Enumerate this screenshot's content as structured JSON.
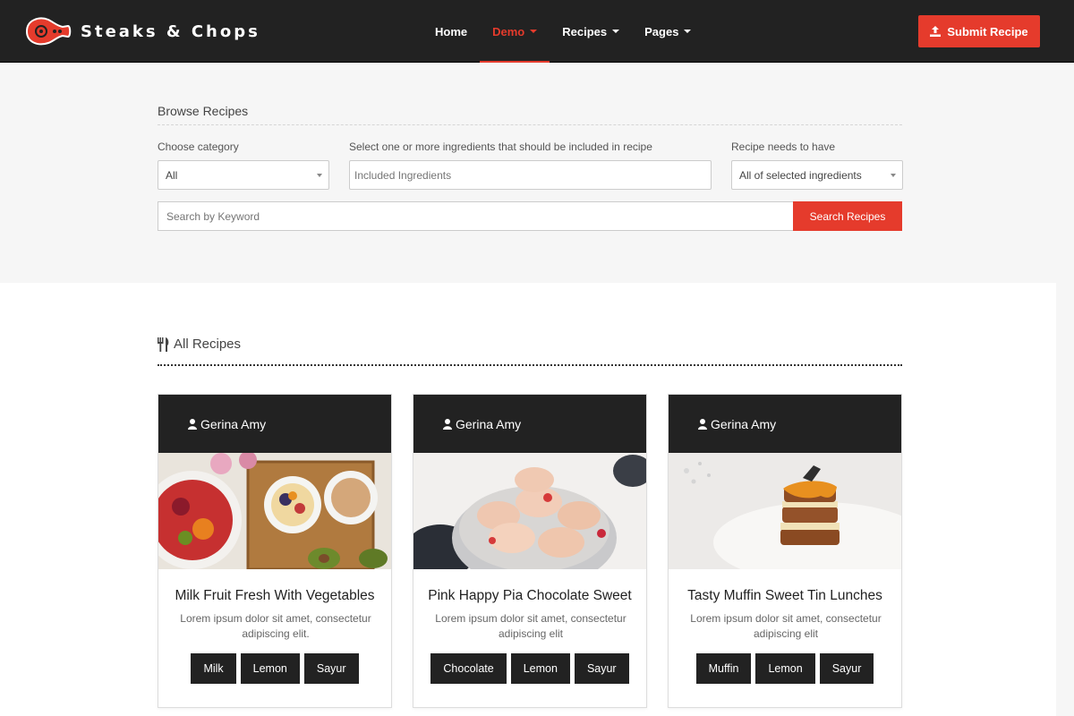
{
  "brand": {
    "name": "Steaks & Chops"
  },
  "nav": {
    "home": "Home",
    "demo": "Demo",
    "recipes": "Recipes",
    "pages": "Pages"
  },
  "submit": {
    "label": "Submit Recipe"
  },
  "search": {
    "title": "Browse Recipes",
    "category_label": "Choose category",
    "category_value": "All",
    "ingredients_label": "Select one or more ingredients that should be included in recipe",
    "ingredients_placeholder": "Included Ingredients",
    "needs_label": "Recipe needs to have",
    "needs_value": "All of selected ingredients",
    "keyword_placeholder": "Search by Keyword",
    "button": "Search Recipes"
  },
  "recipes": {
    "title": "All Recipes",
    "cards": [
      {
        "author": "Gerina Amy",
        "title": "Milk Fruit Fresh With Vegetables",
        "desc": "Lorem ipsum dolor sit amet, consectetur adipiscing elit.",
        "tags": [
          "Milk",
          "Lemon",
          "Sayur"
        ]
      },
      {
        "author": "Gerina Amy",
        "title": "Pink Happy Pia Chocolate Sweet",
        "desc": "Lorem ipsum dolor sit amet, consectetur adipiscing elit",
        "tags": [
          "Chocolate",
          "Lemon",
          "Sayur"
        ]
      },
      {
        "author": "Gerina Amy",
        "title": "Tasty Muffin Sweet Tin Lunches",
        "desc": "Lorem ipsum dolor sit amet, consectetur adipiscing elit",
        "tags": [
          "Muffin",
          "Lemon",
          "Sayur"
        ]
      }
    ]
  },
  "colors": {
    "accent": "#e53b2c",
    "dark": "#222222",
    "light_bg": "#f6f6f6"
  }
}
